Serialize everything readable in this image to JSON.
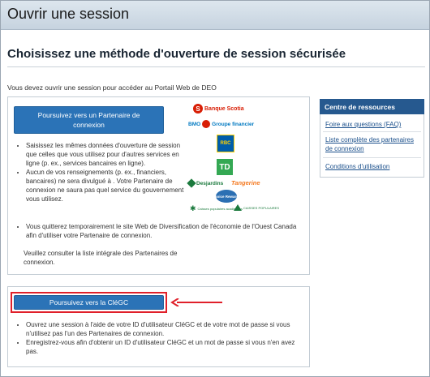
{
  "header": {
    "title": "Ouvrir une session"
  },
  "section_title": "Choisissez une méthode d'ouverture de session sécurisée",
  "intro": "Vous devez ouvrir une session pour accéder au Portail Web de DEO",
  "partner": {
    "button_label": "Poursuivez vers un Partenaire de connexion",
    "bullets": [
      "Saisissez les mêmes données d'ouverture de session que celles que vous utilisez pour d'autres services en ligne (p. ex., services bancaires en ligne).",
      "Aucun de vos renseignements (p. ex., financiers, bancaires) ne sera divulgué à . Votre Partenaire de connexion ne saura pas quel service du gouvernement vous utilisez."
    ],
    "bullet_wide": "Vous quitterez temporairement le site Web de Diversification de l'économie de l'Ouest Canada afin d'utiliser votre Partenaire de connexion.",
    "note": "Veuillez consulter la liste intégrale des Partenaires de connexion."
  },
  "logos": {
    "scotia": "Banque Scotia",
    "bmo_prefix": "BMO",
    "bmo": "Groupe financier",
    "rbc": "RBC",
    "td": "TD",
    "desjardins": "Desjardins",
    "tangerine": "Tangerine",
    "choice": "Choice Rewards",
    "pop1": "Caisses populaires acadiennes",
    "pop2": "CAISSES POPULAIRES"
  },
  "clegc": {
    "button_label": "Poursuivez vers la CléGC",
    "bullets": [
      "Ouvrez une session à l'aide de votre ID d'utilisateur CléGC et de votre mot de passe si vous n'utilisez pas l'un des Partenaires de connexion.",
      "Enregistrez-vous afin d'obtenir un ID d'utilisateur CléGC et un mot de passe si vous n'en avez pas."
    ]
  },
  "sidebar": {
    "title": "Centre de ressources",
    "links": [
      "Foire aux questions (FAQ)",
      "Liste complète des partenaires de connexion",
      "Conditions d'utilisation"
    ]
  },
  "colors": {
    "accent": "#2b73b7",
    "highlight": "#e0202a",
    "sidebar_head": "#26598f"
  }
}
